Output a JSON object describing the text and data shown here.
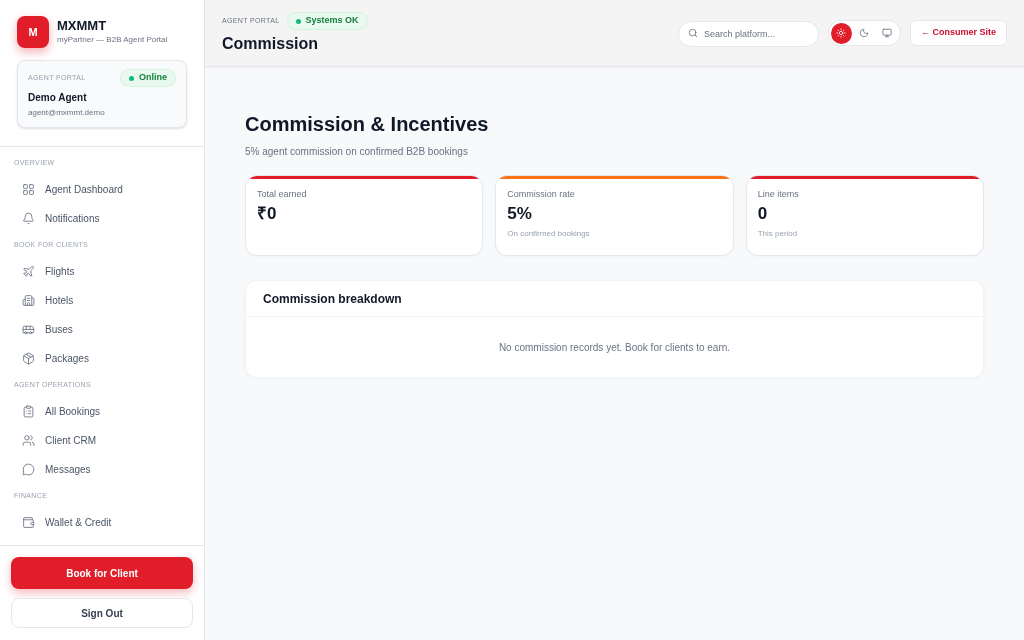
{
  "sidebar": {
    "logo": {
      "letter": "M",
      "title": "MXMMT",
      "subtitle": "myPartner — B2B Agent Portal"
    },
    "agent_card": {
      "label": "AGENT PORTAL",
      "status": "Online",
      "name": "Demo Agent",
      "email": "agent@mxmmt.demo"
    },
    "sections": [
      {
        "title": "OVERVIEW",
        "items": [
          {
            "label": "Agent Dashboard",
            "selected": false
          },
          {
            "label": "Notifications",
            "selected": false
          }
        ]
      },
      {
        "title": "BOOK FOR CLIENTS",
        "items": [
          {
            "label": "Flights",
            "selected": false
          },
          {
            "label": "Hotels",
            "selected": false
          },
          {
            "label": "Buses",
            "selected": false
          },
          {
            "label": "Packages",
            "selected": false
          }
        ]
      },
      {
        "title": "AGENT OPERATIONS",
        "items": [
          {
            "label": "All Bookings",
            "selected": false
          },
          {
            "label": "Client CRM",
            "selected": false
          },
          {
            "label": "Messages",
            "selected": false
          }
        ]
      },
      {
        "title": "FINANCE",
        "items": [
          {
            "label": "Wallet & Credit",
            "selected": false
          }
        ]
      }
    ],
    "primary_button": "Book for Client",
    "secondary_button": "Sign Out"
  },
  "header": {
    "eyebrow": "AGENT PORTAL",
    "status_badge": "Systems OK",
    "title": "Commission",
    "search": {
      "placeholder": "Search platform..."
    },
    "theme_toggle": [
      {
        "selected": true
      },
      {
        "selected": false
      },
      {
        "selected": false
      }
    ],
    "consumer_link": "← Consumer Site"
  },
  "main": {
    "heading": "Commission & Incentives",
    "subtitle": "5% agent commission on confirmed B2B bookings",
    "stats": [
      {
        "label": "Total earned",
        "value": "₹0",
        "color": "#e11d2a"
      },
      {
        "label": "Commission rate",
        "value": "5%",
        "note": "On confirmed bookings",
        "color": "#f97316"
      },
      {
        "label": "Line items",
        "value": "0",
        "note": "This period",
        "color": "#e11d2a"
      }
    ],
    "breakdown": {
      "title": "Commission breakdown",
      "empty_message": "No commission records yet. Book for clients to earn."
    }
  }
}
